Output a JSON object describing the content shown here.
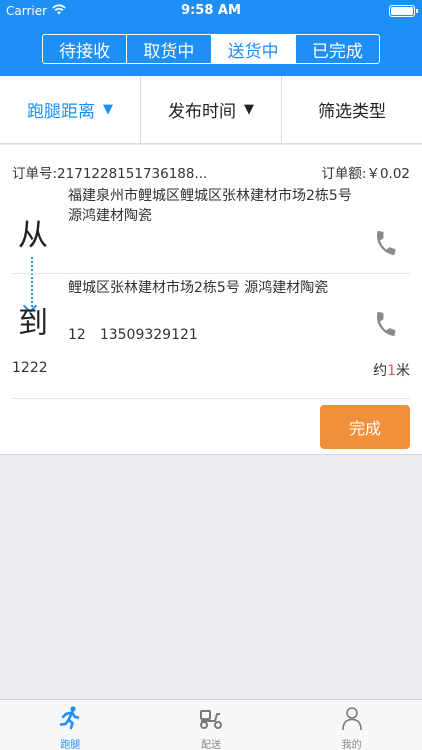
{
  "statusbar": {
    "carrier": "Carrier",
    "time": "9:58 AM"
  },
  "segments": [
    {
      "label": "待接收"
    },
    {
      "label": "取货中"
    },
    {
      "label": "送货中",
      "active": true
    },
    {
      "label": "已完成"
    }
  ],
  "filters": {
    "distance": "跑腿距离",
    "publish_time": "发布时间",
    "type": "筛选类型",
    "arrow": "▼"
  },
  "order": {
    "number": "订单号:2171228151736188...",
    "amount": "订单额:￥0.02",
    "from_char": "从",
    "to_char": "到",
    "from_address": "福建泉州市鲤城区鲤城区张林建材市场2栋5号 源鸿建材陶瓷",
    "to_address": "鲤城区张林建材市场2栋5号 源鸿建材陶瓷",
    "contact_name": "12",
    "contact_phone": "13509329121",
    "note": "1222",
    "distance_prefix": "约",
    "distance_value": "1",
    "distance_unit": "米",
    "complete_label": "完成"
  },
  "tabs": [
    {
      "label": "跑腿",
      "icon": "runner-icon",
      "active": true
    },
    {
      "label": "配送",
      "icon": "scooter-icon"
    },
    {
      "label": "我的",
      "icon": "profile-icon"
    }
  ],
  "colors": {
    "primary": "#1e8ff5",
    "accent_orange": "#f0903a",
    "distance_red": "#e55555",
    "background": "#ececf0"
  }
}
